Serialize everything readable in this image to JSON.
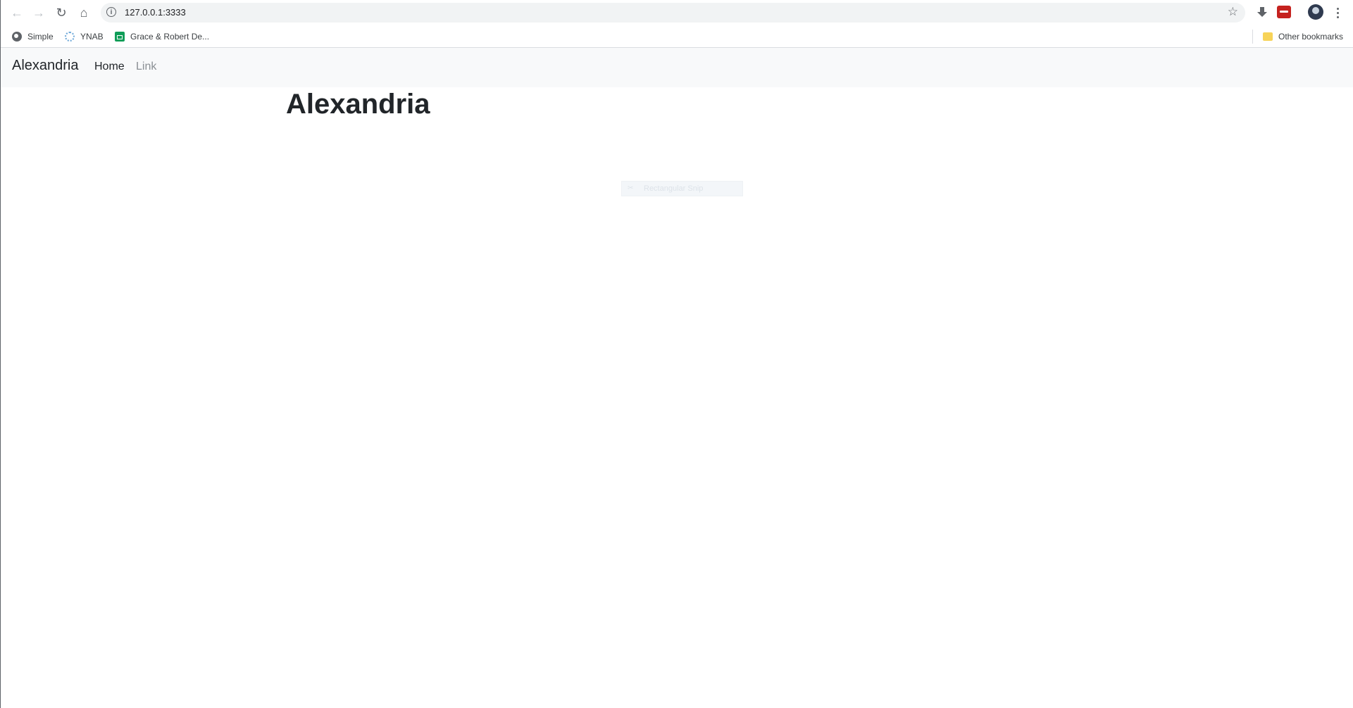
{
  "browser": {
    "back_icon": "arrow-left",
    "forward_icon": "arrow-right",
    "reload_icon": "reload",
    "home_icon": "home",
    "url": "127.0.0.1:3333",
    "bookmarks": [
      {
        "label": "Simple",
        "icon": "globe"
      },
      {
        "label": "YNAB",
        "icon": "ynab"
      },
      {
        "label": "Grace & Robert De...",
        "icon": "sheets"
      }
    ],
    "other_bookmarks": "Other bookmarks"
  },
  "navbar": {
    "brand": "Alexandria",
    "links": [
      "Home",
      "Link"
    ]
  },
  "main": {
    "title": "Alexandria"
  },
  "overlay": {
    "snip_label": "Rectangular Snip"
  }
}
